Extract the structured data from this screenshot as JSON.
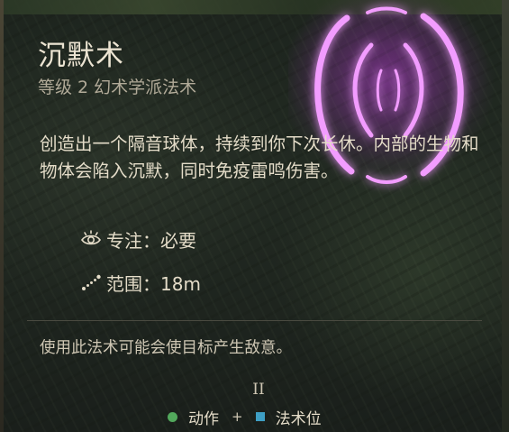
{
  "spell": {
    "name": "沉默术",
    "subtitle": "等级 2 幻术学派法术",
    "description": "创造出一个隔音球体，持续到你下次长休。内部的生物和物体会陷入沉默，同时免疫雷鸣伤害。",
    "concentration_label": "专注：必要",
    "range_label": "范围：18m",
    "warning": "使用此法术可能会使目标产生敌意。",
    "spell_level_roman": "II",
    "cost_action_label": "动作",
    "cost_plus": "+",
    "cost_spell_slot_label": "法术位"
  },
  "icons": {
    "portrait": "silence-spell-rune-icon",
    "concentration": "eye-concentration-icon",
    "range": "range-dotted-line-icon",
    "action": "action-green-circle-icon",
    "spell_slot": "spell-slot-blue-square-icon"
  },
  "colors": {
    "action": "#52a85c",
    "spell_slot": "#3e9fc4",
    "spell_glow": "#e060f0"
  }
}
